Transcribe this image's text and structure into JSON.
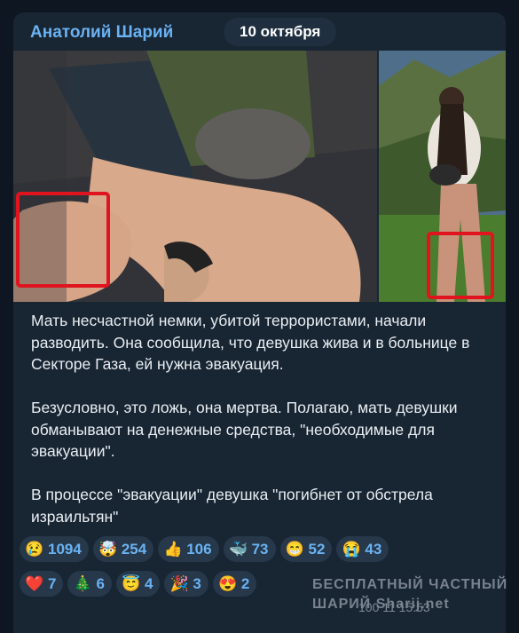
{
  "post": {
    "author": "Анатолий Шарий",
    "date": "10 октября",
    "paragraphs": [
      "Мать несчастной немки, убитой террористами, начали разводить. Она сообщила, что девушка жива и в больнице в Секторе Газа, ей нужна эвакуация.",
      "Безусловно, это ложь, она мертва. Полагаю, мать девушки обманывают на денежные средства, \"необходимые для эвакуации\".",
      "В процессе \"эвакуации\" девушка \"погибнет от обстрела израильтян\""
    ],
    "time": "100  11 15:53",
    "watermark_line1": "БЕСПЛАТНЫЙ ЧАСТНЫЙ",
    "watermark_line2": "ШАРИЙ  Sharij.net"
  },
  "reactions": [
    [
      {
        "emoji": "😢",
        "count": "1094"
      },
      {
        "emoji": "🤯",
        "count": "254"
      },
      {
        "emoji": "👍",
        "count": "106"
      },
      {
        "emoji": "🐳",
        "count": "73"
      },
      {
        "emoji": "😁",
        "count": "52"
      },
      {
        "emoji": "😭",
        "count": "43"
      }
    ],
    [
      {
        "emoji": "❤️",
        "count": "7"
      },
      {
        "emoji": "🎄",
        "count": "6"
      },
      {
        "emoji": "😇",
        "count": "4"
      },
      {
        "emoji": "🎉",
        "count": "3"
      },
      {
        "emoji": "😍",
        "count": "2"
      }
    ]
  ],
  "colors": {
    "bg": "#0e1621",
    "bubble": "#182533",
    "accent": "#6ab2f2",
    "highlight": "#e0141e"
  }
}
